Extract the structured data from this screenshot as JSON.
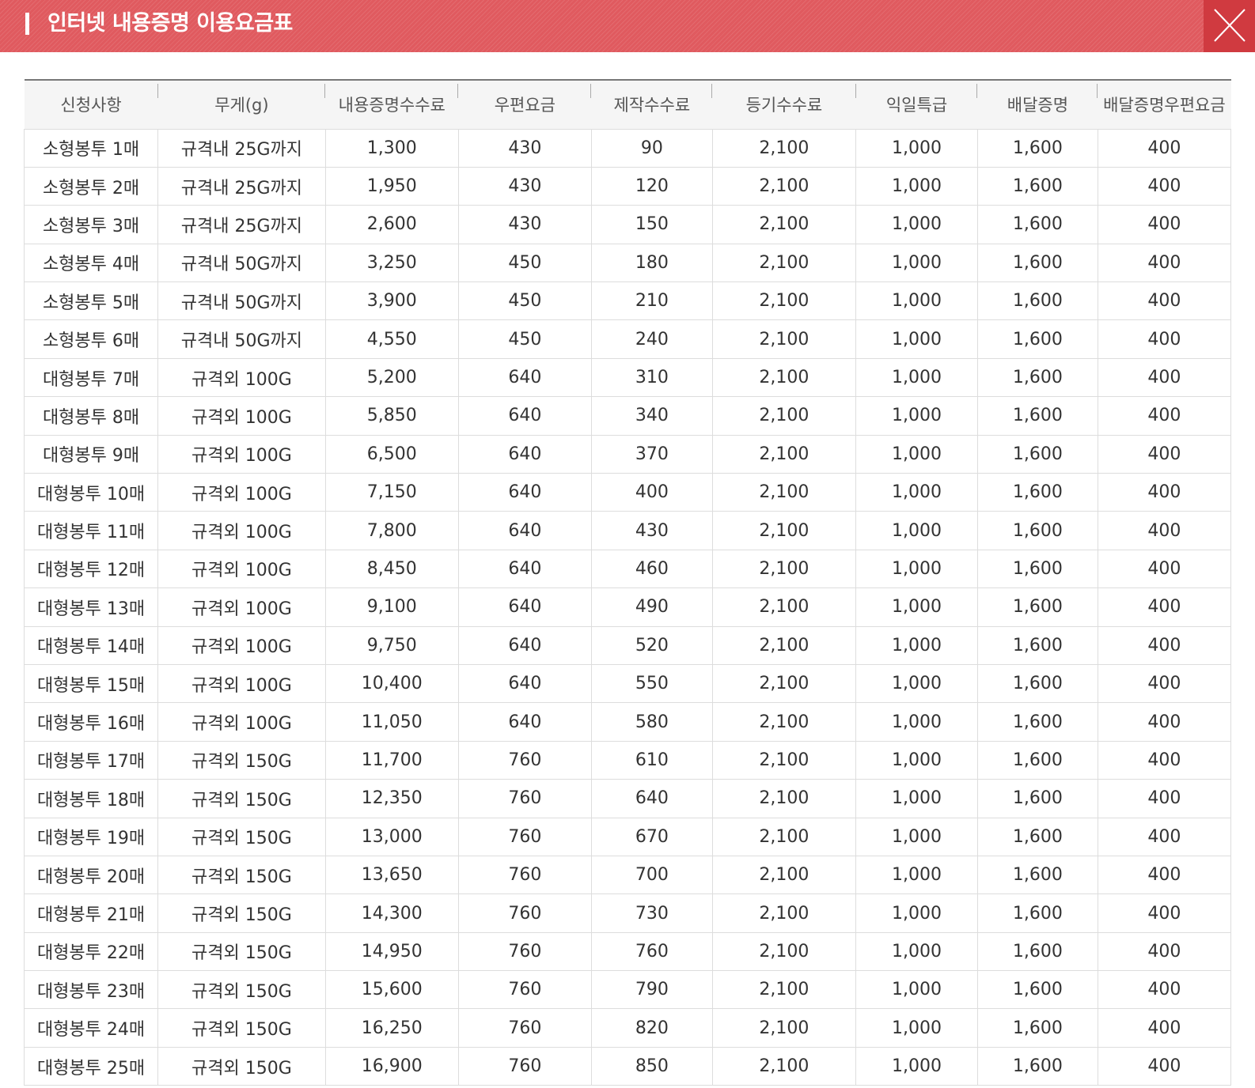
{
  "header": {
    "title": "인터넷 내용증명 이용요금표",
    "close_icon": "close-icon",
    "colors": {
      "bar": "#e05a5f",
      "close_bg": "#d03a40"
    }
  },
  "table": {
    "columns": [
      "신청사항",
      "무게(g)",
      "내용증명수수료",
      "우편요금",
      "제작수수료",
      "등기수수료",
      "익일특급",
      "배달증명",
      "배달증명우편요금"
    ],
    "rows": [
      [
        "소형봉투 1매",
        "규격내 25G까지",
        "1,300",
        "430",
        "90",
        "2,100",
        "1,000",
        "1,600",
        "400"
      ],
      [
        "소형봉투 2매",
        "규격내 25G까지",
        "1,950",
        "430",
        "120",
        "2,100",
        "1,000",
        "1,600",
        "400"
      ],
      [
        "소형봉투 3매",
        "규격내 25G까지",
        "2,600",
        "430",
        "150",
        "2,100",
        "1,000",
        "1,600",
        "400"
      ],
      [
        "소형봉투 4매",
        "규격내 50G까지",
        "3,250",
        "450",
        "180",
        "2,100",
        "1,000",
        "1,600",
        "400"
      ],
      [
        "소형봉투 5매",
        "규격내 50G까지",
        "3,900",
        "450",
        "210",
        "2,100",
        "1,000",
        "1,600",
        "400"
      ],
      [
        "소형봉투 6매",
        "규격내 50G까지",
        "4,550",
        "450",
        "240",
        "2,100",
        "1,000",
        "1,600",
        "400"
      ],
      [
        "대형봉투 7매",
        "규격외 100G",
        "5,200",
        "640",
        "310",
        "2,100",
        "1,000",
        "1,600",
        "400"
      ],
      [
        "대형봉투 8매",
        "규격외 100G",
        "5,850",
        "640",
        "340",
        "2,100",
        "1,000",
        "1,600",
        "400"
      ],
      [
        "대형봉투 9매",
        "규격외 100G",
        "6,500",
        "640",
        "370",
        "2,100",
        "1,000",
        "1,600",
        "400"
      ],
      [
        "대형봉투 10매",
        "규격외 100G",
        "7,150",
        "640",
        "400",
        "2,100",
        "1,000",
        "1,600",
        "400"
      ],
      [
        "대형봉투 11매",
        "규격외 100G",
        "7,800",
        "640",
        "430",
        "2,100",
        "1,000",
        "1,600",
        "400"
      ],
      [
        "대형봉투 12매",
        "규격외 100G",
        "8,450",
        "640",
        "460",
        "2,100",
        "1,000",
        "1,600",
        "400"
      ],
      [
        "대형봉투 13매",
        "규격외 100G",
        "9,100",
        "640",
        "490",
        "2,100",
        "1,000",
        "1,600",
        "400"
      ],
      [
        "대형봉투 14매",
        "규격외 100G",
        "9,750",
        "640",
        "520",
        "2,100",
        "1,000",
        "1,600",
        "400"
      ],
      [
        "대형봉투 15매",
        "규격외 100G",
        "10,400",
        "640",
        "550",
        "2,100",
        "1,000",
        "1,600",
        "400"
      ],
      [
        "대형봉투 16매",
        "규격외 100G",
        "11,050",
        "640",
        "580",
        "2,100",
        "1,000",
        "1,600",
        "400"
      ],
      [
        "대형봉투 17매",
        "규격외 150G",
        "11,700",
        "760",
        "610",
        "2,100",
        "1,000",
        "1,600",
        "400"
      ],
      [
        "대형봉투 18매",
        "규격외 150G",
        "12,350",
        "760",
        "640",
        "2,100",
        "1,000",
        "1,600",
        "400"
      ],
      [
        "대형봉투 19매",
        "규격외 150G",
        "13,000",
        "760",
        "670",
        "2,100",
        "1,000",
        "1,600",
        "400"
      ],
      [
        "대형봉투 20매",
        "규격외 150G",
        "13,650",
        "760",
        "700",
        "2,100",
        "1,000",
        "1,600",
        "400"
      ],
      [
        "대형봉투 21매",
        "규격외 150G",
        "14,300",
        "760",
        "730",
        "2,100",
        "1,000",
        "1,600",
        "400"
      ],
      [
        "대형봉투 22매",
        "규격외 150G",
        "14,950",
        "760",
        "760",
        "2,100",
        "1,000",
        "1,600",
        "400"
      ],
      [
        "대형봉투 23매",
        "규격외 150G",
        "15,600",
        "760",
        "790",
        "2,100",
        "1,000",
        "1,600",
        "400"
      ],
      [
        "대형봉투 24매",
        "규격외 150G",
        "16,250",
        "760",
        "820",
        "2,100",
        "1,000",
        "1,600",
        "400"
      ],
      [
        "대형봉투 25매",
        "규격외 150G",
        "16,900",
        "760",
        "850",
        "2,100",
        "1,000",
        "1,600",
        "400"
      ]
    ]
  }
}
